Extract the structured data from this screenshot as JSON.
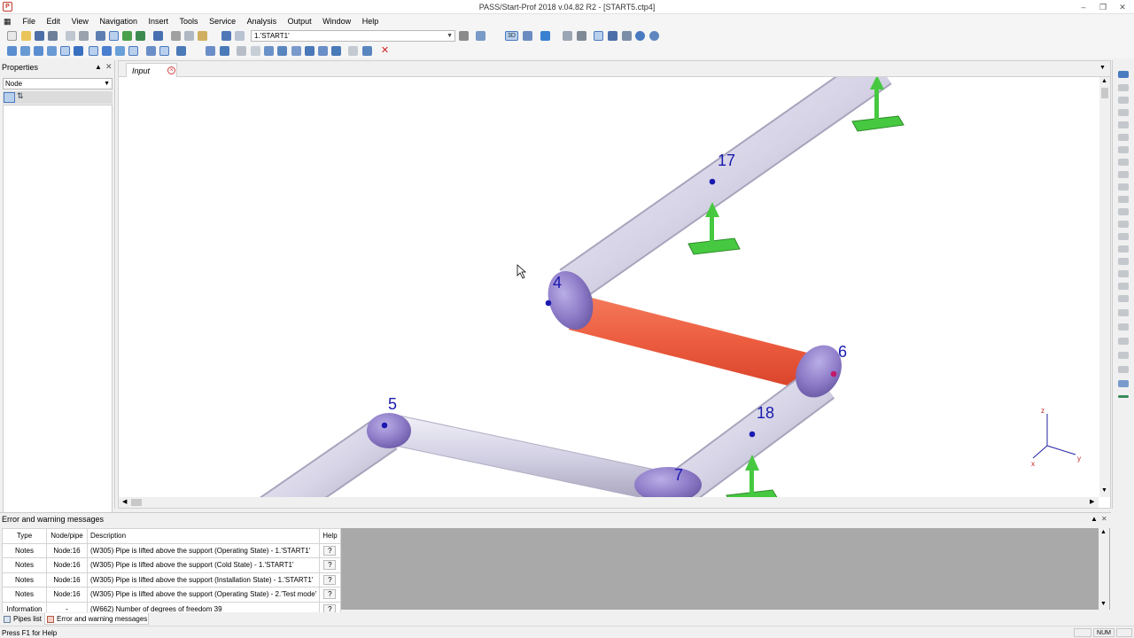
{
  "window": {
    "title": "PASS/Start-Prof 2018 v.04.82 R2 - [START5.ctp4]"
  },
  "menu": [
    "File",
    "Edit",
    "View",
    "Navigation",
    "Insert",
    "Tools",
    "Service",
    "Analysis",
    "Output",
    "Window",
    "Help"
  ],
  "toolbar": {
    "load_case_combo": "1.'START1'"
  },
  "properties_panel": {
    "title": "Properties",
    "selected_type": "Node"
  },
  "document": {
    "tab_label": "Input"
  },
  "model_view": {
    "node_labels": [
      "17",
      "4",
      "6",
      "5",
      "18",
      "7"
    ],
    "axis_labels": [
      "z",
      "x",
      "y"
    ],
    "colors": {
      "pipe": "#d6d4e6",
      "bend": "#8e7cc8",
      "highlighted_pipe": "#ec5c3f",
      "support": "#46c940",
      "node_dot": "#1a1ab0"
    }
  },
  "messages_panel": {
    "title": "Error and warning messages",
    "columns": [
      "Type",
      "Node/pipe",
      "Description",
      "Help"
    ],
    "rows": [
      {
        "type": "Notes",
        "node": "Node:16",
        "desc": "(W305) Pipe is lifted above the support (Operating State) - 1.'START1'",
        "help": "?"
      },
      {
        "type": "Notes",
        "node": "Node:16",
        "desc": "(W305) Pipe is lifted above the support (Cold State) - 1.'START1'",
        "help": "?"
      },
      {
        "type": "Notes",
        "node": "Node:16",
        "desc": "(W305) Pipe is lifted above the support (Installation State) - 1.'START1'",
        "help": "?"
      },
      {
        "type": "Notes",
        "node": "Node:16",
        "desc": "(W305) Pipe is lifted above the support (Operating State) - 2.'Test mode'",
        "help": "?"
      },
      {
        "type": "Information",
        "node": "-",
        "desc": "(W662) Number of degrees of freedom 39",
        "help": "?"
      }
    ]
  },
  "bottom_tabs": [
    "Pipes list",
    "Error and warning messages"
  ],
  "status": {
    "help_text": "Press F1 for Help",
    "num": "NUM"
  }
}
